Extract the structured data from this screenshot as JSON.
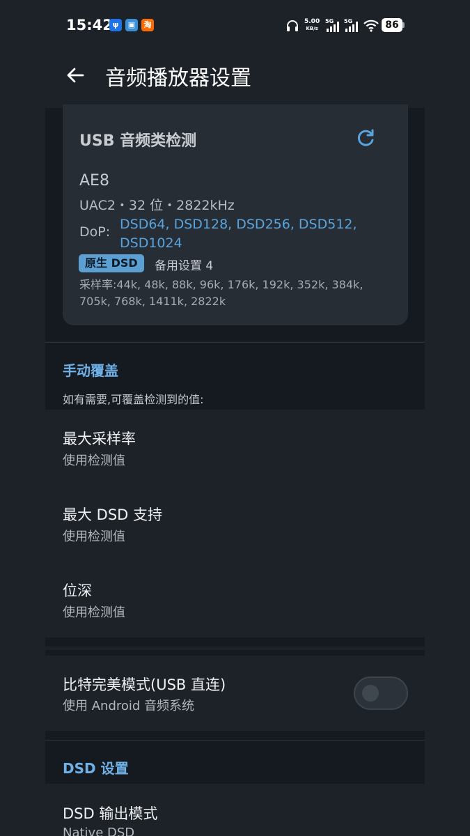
{
  "status_bar": {
    "time": "15:42",
    "notif_icons": [
      "ψ",
      "▣",
      "淘"
    ],
    "net_speed_value": "5.00",
    "net_speed_unit": "KB/s",
    "signal1_label": "5G",
    "signal2_label": "5G",
    "battery": "86"
  },
  "header": {
    "title": "音频播放器设置"
  },
  "usb_card": {
    "title": "USB 音频类检测",
    "device_name": "AE8",
    "spec": "UAC2・32 位・2822kHz",
    "dop_label": "DoP:",
    "dop_values": "DSD64, DSD128, DSD256, DSD512, DSD1024",
    "native_badge": "原生 DSD",
    "alt_setting": "备用设置 4",
    "sample_rates": "采样率:44k, 48k, 88k, 96k, 176k, 192k, 352k, 384k, 705k, 768k, 1411k, 2822k"
  },
  "manual_override": {
    "heading": "手动覆盖",
    "hint": "如有需要,可覆盖检测到的值:",
    "items": [
      {
        "title": "最大采样率",
        "subtitle": "使用检测值"
      },
      {
        "title": "最大 DSD 支持",
        "subtitle": "使用检测值"
      },
      {
        "title": "位深",
        "subtitle": "使用检测值"
      }
    ]
  },
  "bitperfect": {
    "title": "比特完美模式(USB 直连)",
    "subtitle": "使用 Android 音频系统",
    "enabled": false
  },
  "dsd_settings": {
    "heading": "DSD 设置",
    "output_mode_title": "DSD 输出模式",
    "output_mode_value": "Native DSD"
  },
  "colors": {
    "background": "#1d2229",
    "panel": "#141a20",
    "card": "#262d35",
    "accent": "#5aa4de",
    "badge": "#5b9fd3"
  }
}
